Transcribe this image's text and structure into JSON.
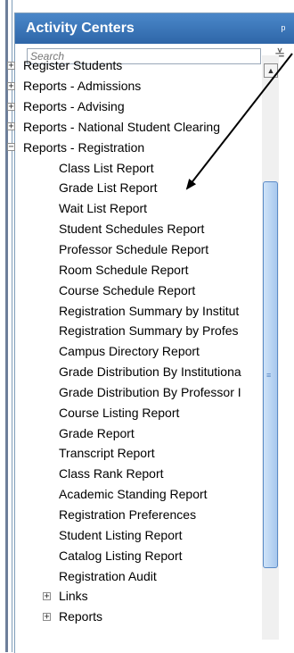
{
  "panel": {
    "title": "Activity Centers"
  },
  "search": {
    "placeholder": "Search"
  },
  "tree": {
    "top": [
      "Register Students",
      "Reports - Admissions",
      "Reports - Advising",
      "Reports - National Student Clearing",
      "Reports - Registration"
    ],
    "reports": [
      "Class List Report",
      "Grade List Report",
      "Wait List Report",
      "Student Schedules Report",
      "Professor Schedule Report",
      "Room Schedule Report",
      "Course Schedule Report",
      "Registration Summary by Institut",
      "Registration Summary by Profes",
      "Campus Directory Report",
      "Grade Distribution By Institutiona",
      "Grade Distribution By Professor I",
      "Course Listing Report",
      "Grade Report",
      "Transcript Report",
      "Class Rank Report",
      "Academic Standing Report",
      "Registration Preferences",
      "Student Listing Report",
      "Catalog Listing Report",
      "Registration Audit"
    ],
    "bottom": [
      "Links",
      "Reports"
    ]
  },
  "colors": {
    "header": "#3a76bb",
    "scroll_thumb": "#b9d5f3",
    "arrow": "#000000"
  },
  "icons": {
    "pin": "pin-icon",
    "collapse": "double-chevron-down-icon",
    "expand": "plus-box-icon",
    "collapse_tree": "minus-box-icon"
  }
}
